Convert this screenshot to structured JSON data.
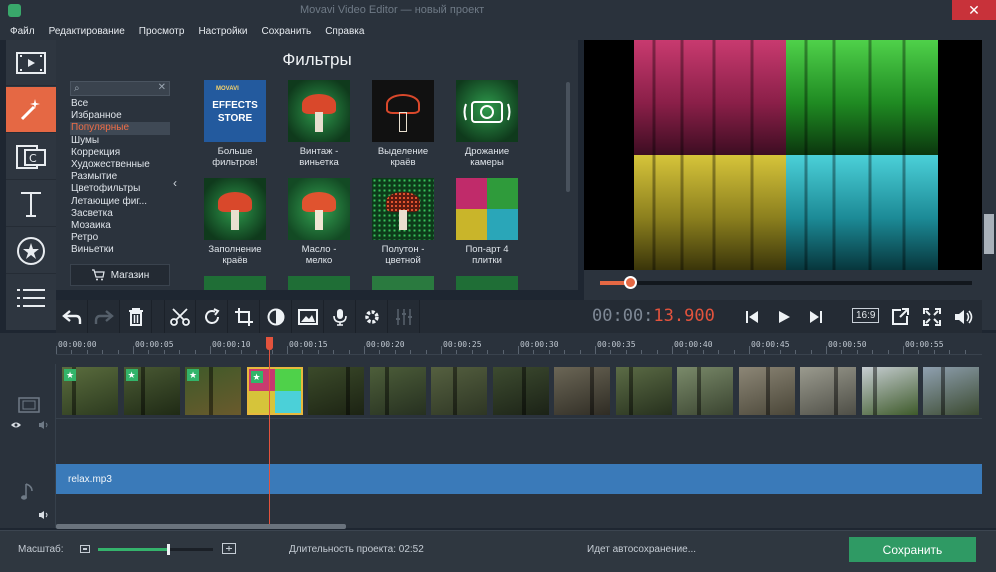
{
  "window": {
    "title": "Movavi Video Editor — новый проект",
    "close_symbol": "✕"
  },
  "menu": [
    "Файл",
    "Редактирование",
    "Просмотр",
    "Настройки",
    "Сохранить",
    "Справка"
  ],
  "rail": [
    "import-icon",
    "filters-icon",
    "transitions-icon",
    "titles-icon",
    "stickers-icon",
    "more-icon"
  ],
  "filters": {
    "title": "Фильтры",
    "search_placeholder": "",
    "categories": [
      "Все",
      "Избранное",
      "Популярные",
      "Шумы",
      "Коррекция",
      "Художественные",
      "Размытие",
      "Цветофильтры",
      "Летающие фиг...",
      "Засветка",
      "Мозаика",
      "Ретро",
      "Виньетки"
    ],
    "active_category": "Популярные",
    "store_label": "Магазин",
    "store_tile": {
      "brand": "MOVAVI",
      "line1": "EFFECTS",
      "line2": "STORE"
    },
    "items": [
      {
        "line1": "Больше",
        "line2": "фильтров!"
      },
      {
        "line1": "Винтаж -",
        "line2": "виньетка"
      },
      {
        "line1": "Выделение",
        "line2": "краёв"
      },
      {
        "line1": "Дрожание",
        "line2": "камеры"
      },
      {
        "line1": "Заполнение",
        "line2": "краёв"
      },
      {
        "line1": "Масло -",
        "line2": "мелко"
      },
      {
        "line1": "Полутон -",
        "line2": "цветной"
      },
      {
        "line1": "Поп-арт 4",
        "line2": "плитки"
      }
    ]
  },
  "player": {
    "timecode_dim": "00:00:",
    "timecode_red": "13.900",
    "ratio": "16:9",
    "seek_fraction": 0.08
  },
  "ruler_labels": [
    "00:00:00",
    "00:00:05",
    "00:00:10",
    "00:00:15",
    "00:00:20",
    "00:00:25",
    "00:00:30",
    "00:00:35",
    "00:00:40",
    "00:00:45",
    "00:00:50",
    "00:00:55"
  ],
  "audio": {
    "file": "relax.mp3"
  },
  "status": {
    "zoom_label": "Масштаб:",
    "zoom_fraction": 0.6,
    "duration": "Длительность проекта: 02:52",
    "autosave": "Идет автосохранение...",
    "save_label": "Сохранить"
  },
  "colors": {
    "accent": "#e56844",
    "timecode": "#e3533d",
    "save": "#2f9a64",
    "audio": "#3a7ab9",
    "favorite": "#33b46a"
  }
}
